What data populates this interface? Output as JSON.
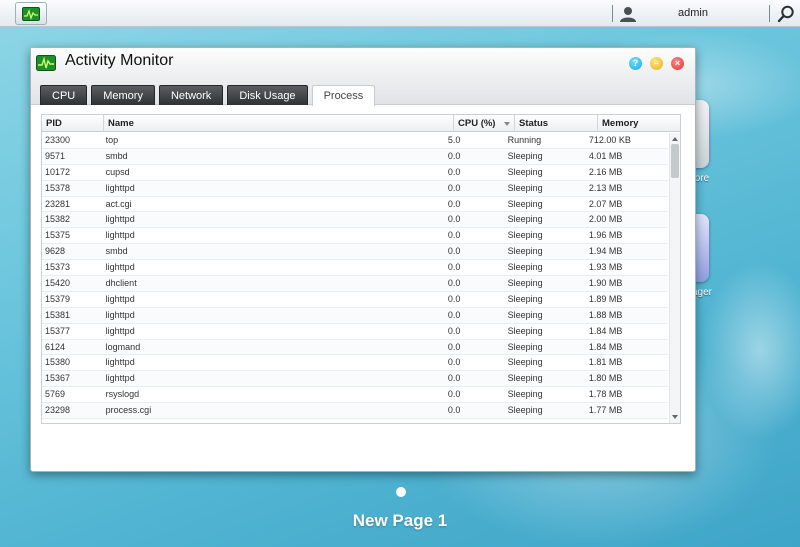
{
  "taskbar": {
    "app_icon": "activity-monitor-icon",
    "user_icon": "user-icon",
    "username": "admin",
    "search_icon": "search-icon"
  },
  "desktop": {
    "icon_labels": [
      "tore",
      "ager"
    ],
    "page_label": "New Page 1"
  },
  "window": {
    "title": "Activity Monitor",
    "controls": [
      "help-icon",
      "minimize-icon",
      "close-icon"
    ],
    "tabs": [
      {
        "label": "CPU",
        "active": false
      },
      {
        "label": "Memory",
        "active": false
      },
      {
        "label": "Network",
        "active": false
      },
      {
        "label": "Disk Usage",
        "active": false
      },
      {
        "label": "Process",
        "active": true
      }
    ]
  },
  "table": {
    "columns": [
      "PID",
      "Name",
      "CPU (%)",
      "Status",
      "Memory"
    ],
    "sorted_column": "CPU (%)",
    "rows": [
      [
        "23300",
        "top",
        "5.0",
        "Running",
        "712.00 KB"
      ],
      [
        "9571",
        "smbd",
        "0.0",
        "Sleeping",
        "4.01 MB"
      ],
      [
        "10172",
        "cupsd",
        "0.0",
        "Sleeping",
        "2.16 MB"
      ],
      [
        "15378",
        "lighttpd",
        "0.0",
        "Sleeping",
        "2.13 MB"
      ],
      [
        "23281",
        "act.cgi",
        "0.0",
        "Sleeping",
        "2.07 MB"
      ],
      [
        "15382",
        "lighttpd",
        "0.0",
        "Sleeping",
        "2.00 MB"
      ],
      [
        "15375",
        "lighttpd",
        "0.0",
        "Sleeping",
        "1.96 MB"
      ],
      [
        "9628",
        "smbd",
        "0.0",
        "Sleeping",
        "1.94 MB"
      ],
      [
        "15373",
        "lighttpd",
        "0.0",
        "Sleeping",
        "1.93 MB"
      ],
      [
        "15420",
        "dhclient",
        "0.0",
        "Sleeping",
        "1.90 MB"
      ],
      [
        "15379",
        "lighttpd",
        "0.0",
        "Sleeping",
        "1.89 MB"
      ],
      [
        "15381",
        "lighttpd",
        "0.0",
        "Sleeping",
        "1.88 MB"
      ],
      [
        "15377",
        "lighttpd",
        "0.0",
        "Sleeping",
        "1.84 MB"
      ],
      [
        "6124",
        "logmand",
        "0.0",
        "Sleeping",
        "1.84 MB"
      ],
      [
        "15380",
        "lighttpd",
        "0.0",
        "Sleeping",
        "1.81 MB"
      ],
      [
        "15367",
        "lighttpd",
        "0.0",
        "Sleeping",
        "1.80 MB"
      ],
      [
        "5769",
        "rsyslogd",
        "0.0",
        "Sleeping",
        "1.78 MB"
      ],
      [
        "23298",
        "process.cgi",
        "0.0",
        "Sleeping",
        "1.77 MB"
      ]
    ]
  }
}
